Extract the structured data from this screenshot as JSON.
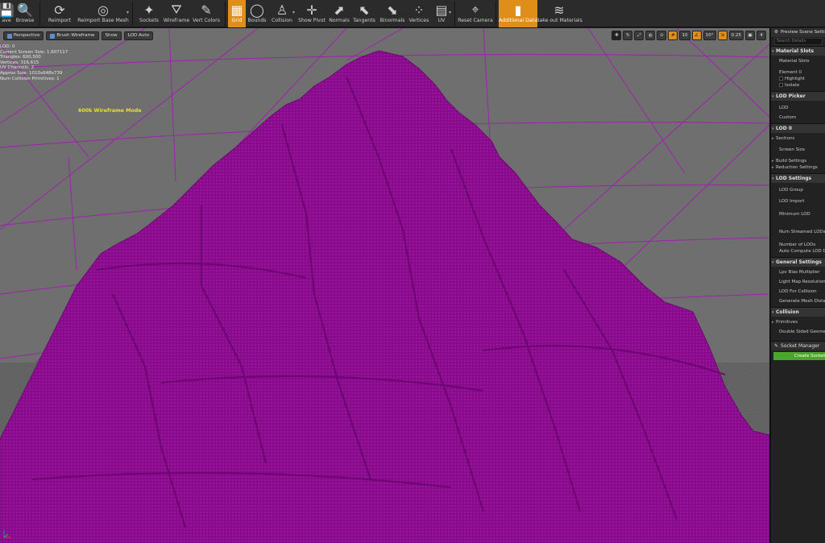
{
  "toolbar": {
    "items": [
      {
        "label": "ave",
        "icon": "save-icon"
      },
      {
        "label": "Browse",
        "icon": "browse-icon"
      },
      {
        "label": "Reimport",
        "icon": "reimport-icon"
      },
      {
        "label": "Reimport Base Mesh",
        "icon": "reimport-base-mesh-icon"
      },
      {
        "label": "Sockets",
        "icon": "sockets-icon"
      },
      {
        "label": "Wireframe",
        "icon": "wireframe-icon"
      },
      {
        "label": "Vert Colors",
        "icon": "vert-colors-icon"
      },
      {
        "label": "Grid",
        "icon": "grid-icon"
      },
      {
        "label": "Bounds",
        "icon": "bounds-icon"
      },
      {
        "label": "Collision",
        "icon": "collision-icon"
      },
      {
        "label": "Show Pivot",
        "icon": "show-pivot-icon"
      },
      {
        "label": "Normals",
        "icon": "normals-icon"
      },
      {
        "label": "Tangents",
        "icon": "tangents-icon"
      },
      {
        "label": "Binormals",
        "icon": "binormals-icon"
      },
      {
        "label": "Vertices",
        "icon": "vertices-icon"
      },
      {
        "label": "UV",
        "icon": "uv-icon"
      },
      {
        "label": "Reset Camera",
        "icon": "reset-camera-icon"
      },
      {
        "label": "Additional Data",
        "icon": "additional-data-icon"
      },
      {
        "label": "Bake out Materials",
        "icon": "bake-materials-icon"
      }
    ],
    "active_items": [
      "Grid",
      "Additional Data"
    ]
  },
  "viewport": {
    "perspective_label": "Perspective",
    "brush_wireframe_label": "Brush Wireframe",
    "show_label": "Show",
    "lod_auto_label": "LOD Auto",
    "grid_snap": "10",
    "rotation_snap": "10°",
    "scale_snap": "0.25",
    "camera_speed": "4",
    "stats": [
      "LOD: 0",
      "Current Screen Size: 1.607117",
      "Triangles: 600,500",
      "Vertices: 316,615",
      "UV Channels: 2",
      "Approx Size: 1010x648x739",
      "Num Collision Primitives: 1"
    ],
    "annotation": "600k Wireframe Mode",
    "mesh_color": "#8a0a8e",
    "grid_line_color": "#a020b0",
    "background_color": "#6f6f6f"
  },
  "details_panel": {
    "tab_title": "Preview Scene Settings",
    "search_placeholder": "Search Details",
    "sections": [
      {
        "title": "Material Slots",
        "rows": [
          {
            "label": "Material Slots",
            "kind": "text"
          },
          {
            "label": "Element 0",
            "kind": "text"
          },
          {
            "label": "Highlight",
            "kind": "check"
          },
          {
            "label": "Isolate",
            "kind": "check"
          }
        ]
      },
      {
        "title": "LOD Picker",
        "rows": [
          {
            "label": "LOD",
            "kind": "text"
          },
          {
            "label": "Custom",
            "kind": "text"
          }
        ]
      },
      {
        "title": "LOD 0",
        "rows": [
          {
            "label": "Sections",
            "kind": "expand"
          },
          {
            "label": "Screen Size",
            "kind": "text"
          },
          {
            "label": "Build Settings",
            "kind": "expand"
          },
          {
            "label": "Reduction Settings",
            "kind": "expand"
          }
        ]
      },
      {
        "title": "LOD Settings",
        "rows": [
          {
            "label": "LOD Group",
            "kind": "text"
          },
          {
            "label": "LOD Import",
            "kind": "text"
          },
          {
            "label": "Minimum LOD",
            "kind": "text"
          },
          {
            "label": "Num Streamed LODs",
            "kind": "text"
          },
          {
            "label": "Number of LODs",
            "kind": "text"
          },
          {
            "label": "Auto Compute LOD Distances",
            "kind": "text"
          }
        ]
      },
      {
        "title": "General Settings",
        "rows": [
          {
            "label": "Lpv Bias Multiplier",
            "kind": "text"
          },
          {
            "label": "Light Map Resolution",
            "kind": "text"
          },
          {
            "label": "LOD For Collision",
            "kind": "text"
          },
          {
            "label": "Generate Mesh Distance Field",
            "kind": "text"
          }
        ]
      },
      {
        "title": "Collision",
        "rows": [
          {
            "label": "Primitives",
            "kind": "expand"
          },
          {
            "label": "Double Sided Geometry",
            "kind": "text"
          }
        ]
      }
    ],
    "socket_manager_title": "Socket Manager",
    "create_socket_label": "Create Socket"
  }
}
